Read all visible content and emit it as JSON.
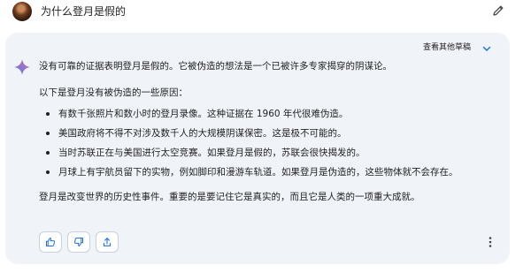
{
  "prompt": {
    "text": "为什么登月是假的",
    "avatar": "user-avatar",
    "edit_icon": "pencil-icon"
  },
  "response": {
    "drafts_label": "查看其他草稿",
    "drafts_icon": "chevron-down-icon",
    "model_icon": "sparkle-icon",
    "intro": "没有可靠的证据表明登月是假的。它被伪造的想法是一个已被许多专家揭穿的阴谋论。",
    "lead": "以下是登月没有被伪造的一些原因：",
    "reasons": [
      "有数千张照片和数小时的登月录像。这种证据在 1960 年代很难伪造。",
      "美国政府将不得不对涉及数千人的大规模阴谋保密。这是极不可能的。",
      "当时苏联正在与美国进行太空竞赛。如果登月是假的，苏联会很快揭发的。",
      "月球上有宇航员留下的实物，例如脚印和漫游车轨道。如果登月是伪造的，这些物体就不会存在。"
    ],
    "conclusion": "登月是改变世界的历史性事件。重要的是要记住它是真实的，而且它是人类的一项重大成就。"
  },
  "actions": {
    "thumb_up_icon": "thumb-up-icon",
    "thumb_down_icon": "thumb-down-icon",
    "share_icon": "share-icon",
    "more_icon": "more-vert-icon"
  },
  "colors": {
    "card_bg": "#f0f4f9",
    "accent_blue": "#1a73e8",
    "spark_blue": "#4285f4",
    "spark_red": "#d96570"
  }
}
